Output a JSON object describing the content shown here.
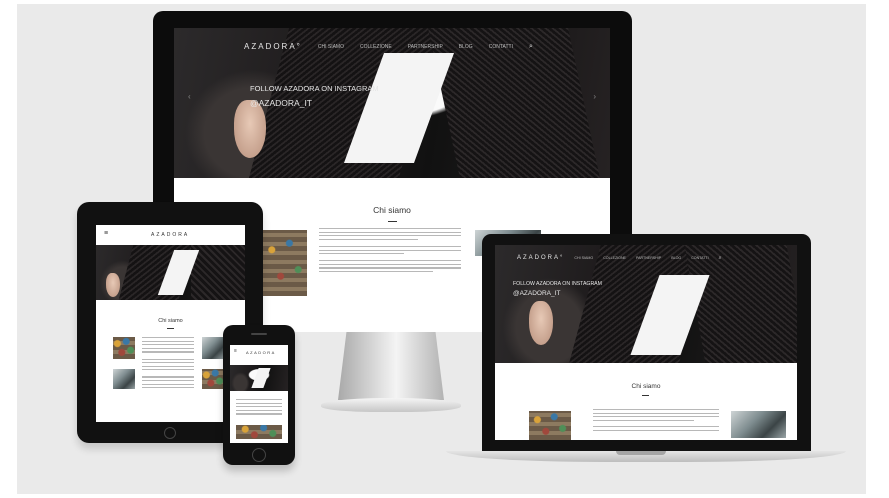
{
  "brand": "AZADORA",
  "brand_mark": "AZADORA°",
  "desktop": {
    "nav_items": [
      "Chi siamo",
      "Collezione",
      "Partnership",
      "Blog",
      "Contatti"
    ],
    "hero_lines": [
      "FOLLOW AZADORA ON INSTAGRAM",
      "@AZADORA_IT"
    ],
    "section_title": "Chi siamo"
  },
  "tablet": {
    "section_title": "Chi siamo"
  },
  "laptop": {
    "nav_items": [
      "Chi siamo",
      "Collezione",
      "Partnership",
      "Blog",
      "Contatti"
    ],
    "hero_lines": [
      "FOLLOW AZADORA ON INSTAGRAM",
      "@AZADORA_IT"
    ],
    "section_title": "Chi siamo"
  },
  "phone": {
    "logo": "AZADORA"
  },
  "colors": {
    "background": "#eaeaea",
    "device_frame": "#111111",
    "hero_dark": "#1e1b1c",
    "content_bg": "#ffffff"
  },
  "icons": [
    "search-icon",
    "menu-icon",
    "chevron-left-icon",
    "chevron-right-icon",
    "home-button-icon",
    "apple-logo-icon"
  ]
}
